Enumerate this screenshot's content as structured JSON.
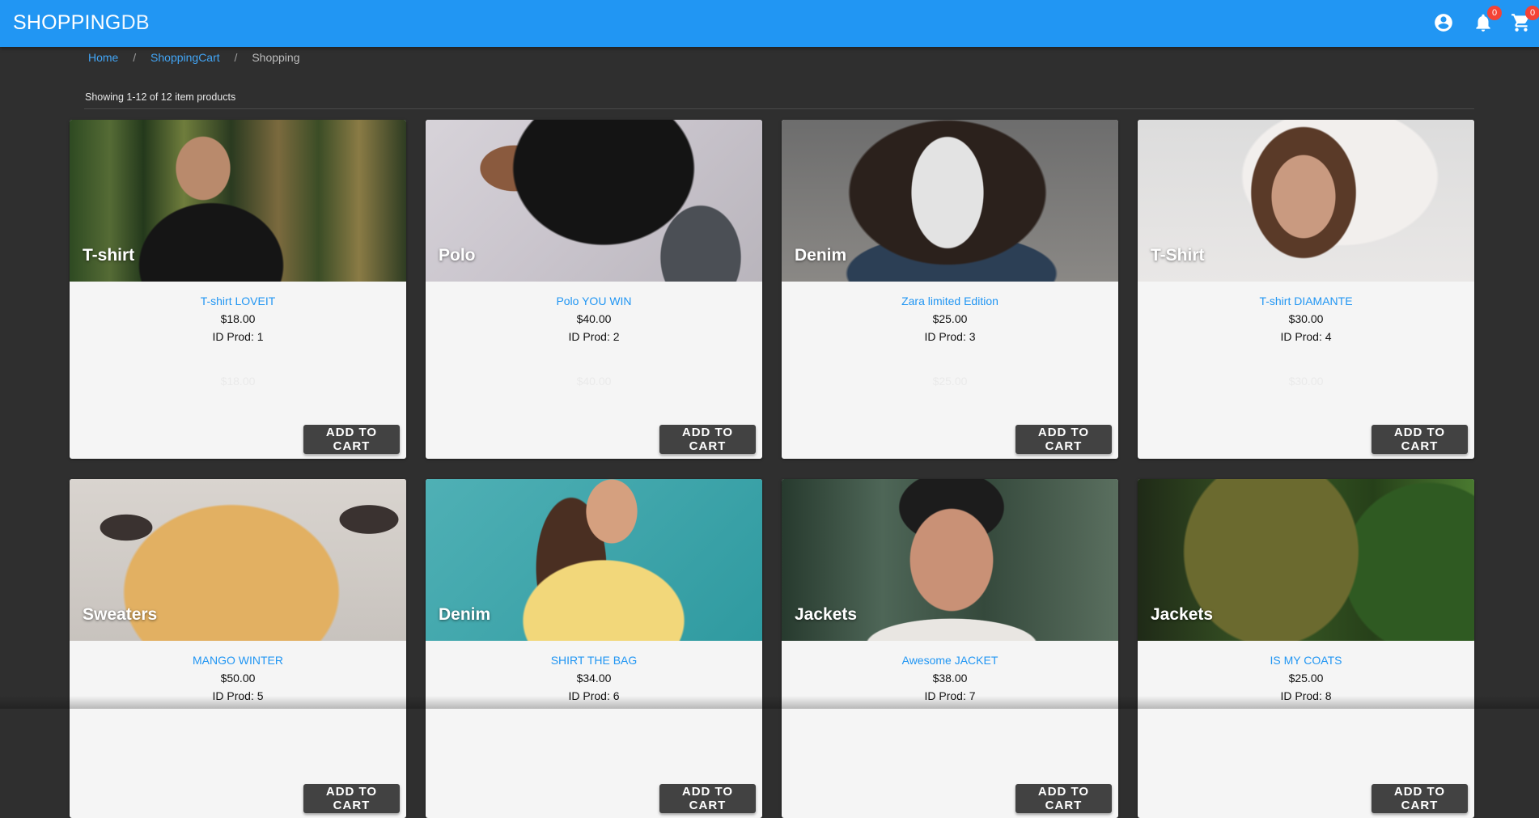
{
  "app": {
    "brand_main": "SHOPPING",
    "brand_suffix": "DB"
  },
  "header": {
    "icons": [
      "account-circle-icon",
      "bell-icon",
      "cart-icon"
    ],
    "notifications_count": "0",
    "cart_count": "0"
  },
  "breadcrumb": {
    "home": "Home",
    "cart": "ShoppingCart",
    "current": "Shopping"
  },
  "listing": {
    "showing": "Showing 1-12 of 12 item products"
  },
  "add_to_cart_label": "ADD TO CART",
  "products": [
    {
      "category": "T-shirt",
      "title": "T-shirt LOVEIT",
      "price": "$18.00",
      "id_label": "ID Prod: 1",
      "price_ghost": "$18.00"
    },
    {
      "category": "Polo",
      "title": "Polo YOU WIN",
      "price": "$40.00",
      "id_label": "ID Prod: 2",
      "price_ghost": "$40.00"
    },
    {
      "category": "Denim",
      "title": "Zara limited Edition",
      "price": "$25.00",
      "id_label": "ID Prod: 3",
      "price_ghost": "$25.00"
    },
    {
      "category": "T-Shirt",
      "title": "T-shirt DIAMANTE",
      "price": "$30.00",
      "id_label": "ID Prod: 4",
      "price_ghost": "$30.00"
    },
    {
      "category": "Sweaters",
      "title": "MANGO WINTER",
      "price": "$50.00",
      "id_label": "ID Prod: 5"
    },
    {
      "category": "Denim",
      "title": "SHIRT THE BAG",
      "price": "$34.00",
      "id_label": "ID Prod: 6"
    },
    {
      "category": "Jackets",
      "title": "Awesome JACKET",
      "price": "$38.00",
      "id_label": "ID Prod: 7"
    },
    {
      "category": "Jackets",
      "title": "IS MY COATS",
      "price": "$25.00",
      "id_label": "ID Prod: 8"
    }
  ],
  "colors": {
    "appbar": "#2196f3",
    "background": "#2f2f2f",
    "badge": "#f44336",
    "link": "#2196f3",
    "button": "#424242"
  }
}
